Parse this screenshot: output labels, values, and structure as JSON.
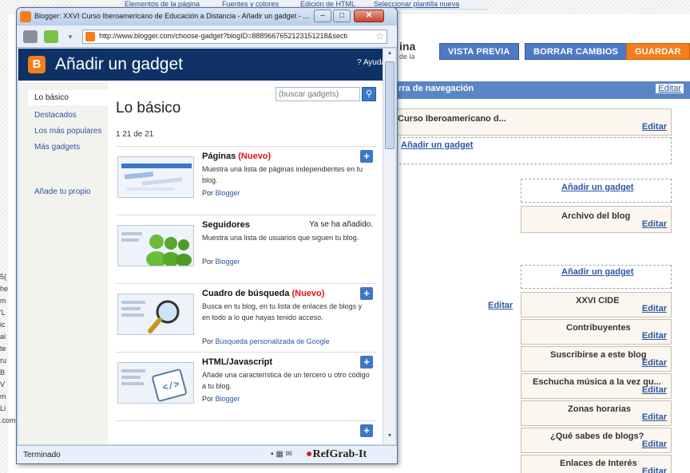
{
  "background": {
    "top_tabs": [
      "Elementos de la página",
      "Fuentes y colores",
      "Edición de HTML",
      "Seleccionar plantilla nueva"
    ],
    "title_fragment": "ina",
    "subtitle_fragment": "de la",
    "buttons": {
      "preview": "VISTA PREVIA",
      "clear": "BORRAR CAMBIOS",
      "save": "GUARDAR"
    },
    "navbar": {
      "title": "rra de navegación",
      "edit": "Editar"
    },
    "header_widget": {
      "title": "Curso Iberoamericano d...",
      "edit": "Editar"
    },
    "add_gadget": "Añadir un gadget",
    "main_edit": "Editar",
    "sidebar_gadgets": [
      {
        "title": "Archivo del blog",
        "edit": "Editar"
      },
      {
        "title": "XXVI CIDE",
        "edit": "Editar"
      },
      {
        "title": "Contribuyentes",
        "edit": "Editar"
      },
      {
        "title": "Suscribirse a este blog",
        "edit": "Editar"
      },
      {
        "title": "Eschucha música a la vez qu...",
        "edit": "Editar"
      },
      {
        "title": "Zonas horarias",
        "edit": "Editar"
      },
      {
        "title": "¿Qué sabes de blogs?",
        "edit": "Editar"
      },
      {
        "title": "Enlaces de Interés",
        "edit": "Editar"
      }
    ],
    "left_fragments": [
      "5(",
      "he",
      "m",
      "'L",
      "ic",
      "ai",
      "te",
      "ru",
      "B",
      "V",
      "m",
      "Li",
      ".com » Consig..."
    ]
  },
  "window": {
    "title": "Blogger: XXVI Curso Iberoamericano de Educación a Distancia - Añadir un gadget - ...",
    "url": "http://www.blogger.com/choose-gadget?blogID=8889667652123151218&secti",
    "status": "Terminado",
    "watermark": "RefGrab-It"
  },
  "dialog": {
    "logo_letter": "B",
    "title": "Añadir un gadget",
    "help": "? Ayuda",
    "nav": [
      "Lo básico",
      "Destacados",
      "Los más populares",
      "Más gadgets"
    ],
    "add_own": "Añade tu propio",
    "section_title": "Lo básico",
    "search_placeholder": "(buscar gadgets)",
    "count": "1 21 de 21",
    "gadgets": [
      {
        "name": "Páginas",
        "new": "(Nuevo)",
        "description": "Muestra una lista de páginas independientes en tu blog.",
        "by": "Por",
        "author": "Blogger",
        "status": ""
      },
      {
        "name": "Seguidores",
        "new": "",
        "description": "Muestra una lista de usuarios que siguen tu blog.",
        "by": "Por",
        "author": "Blogger",
        "status": "Ya se ha añadido."
      },
      {
        "name": "Cuadro de búsqueda",
        "new": "(Nuevo)",
        "description": "Busca en tu blog, en tu lista de enlaces de blogs y en todo a lo que hayas tenido acceso.",
        "by": "Por",
        "author": "Búsqueda personalizada de Google",
        "status": ""
      },
      {
        "name": "HTML/Javascript",
        "new": "",
        "description": "Añade una característica de un tercero u otro código a tu blog.",
        "by": "Por",
        "author": "Blogger",
        "status": ""
      }
    ]
  },
  "colors": {
    "blogger_orange": "#f57d1c",
    "header_navy": "#0e3266",
    "link_blue": "#2a55a5",
    "new_red": "#e0111b"
  }
}
